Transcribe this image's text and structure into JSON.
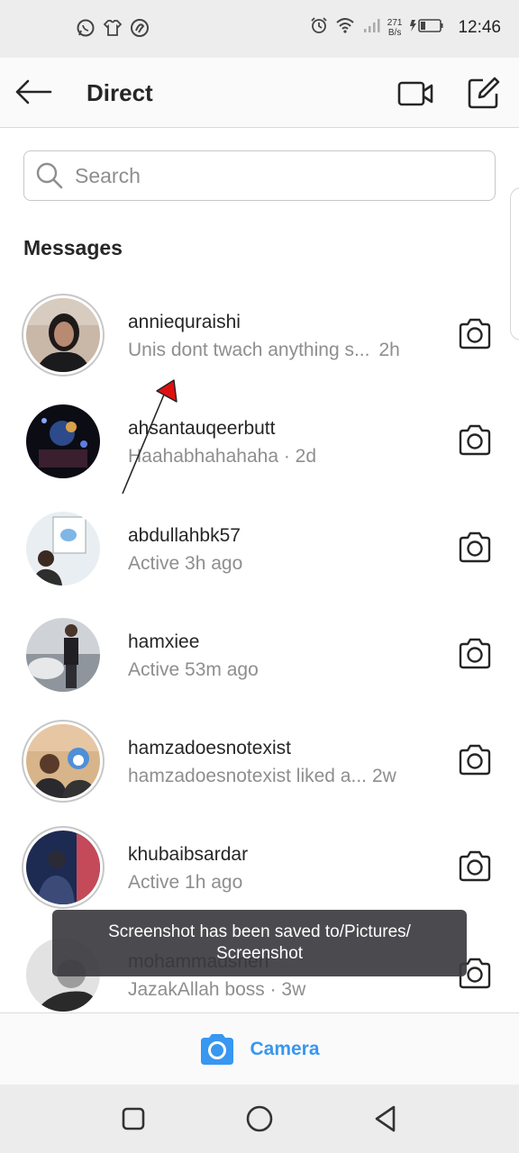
{
  "status_bar": {
    "time": "12:46",
    "speed_value": "271",
    "speed_unit": "B/s",
    "left_icons": [
      "whatsapp-icon",
      "shirt-icon",
      "app-icon"
    ],
    "right_icons": [
      "alarm-icon",
      "wifi-icon",
      "signal-icon",
      "battery-icon"
    ]
  },
  "header": {
    "title": "Direct"
  },
  "search": {
    "placeholder": "Search"
  },
  "section_title": "Messages",
  "messages": [
    {
      "username": "anniequraishi",
      "preview": "Unis dont twach anything s...",
      "time": "2h",
      "separator": "",
      "ring": true
    },
    {
      "username": "ahsantauqeerbutt",
      "preview": "Haahabhahahaha",
      "time": "2d",
      "separator": " · ",
      "ring": false
    },
    {
      "username": "abdullahbk57",
      "preview": "Active 3h ago",
      "time": "",
      "separator": "",
      "ring": false
    },
    {
      "username": "hamxiee",
      "preview": "Active 53m ago",
      "time": "",
      "separator": "",
      "ring": false
    },
    {
      "username": "hamzadoesnotexist",
      "preview": "hamzadoesnotexist liked a...",
      "time": "2w",
      "separator": "",
      "ring": true
    },
    {
      "username": "khubaibsardar",
      "preview": "Active 1h ago",
      "time": "",
      "separator": "",
      "ring": true
    },
    {
      "username": "mohammadsheri",
      "preview": "JazakAllah boss",
      "time": "3w",
      "separator": " · ",
      "ring": false
    }
  ],
  "toast": {
    "line1": "Screenshot has been saved to/Pictures/",
    "line2": "Screenshot"
  },
  "bottom_bar": {
    "label": "Camera"
  },
  "colors": {
    "accent": "#3897f0",
    "annotation_arrow": "#e01010"
  }
}
